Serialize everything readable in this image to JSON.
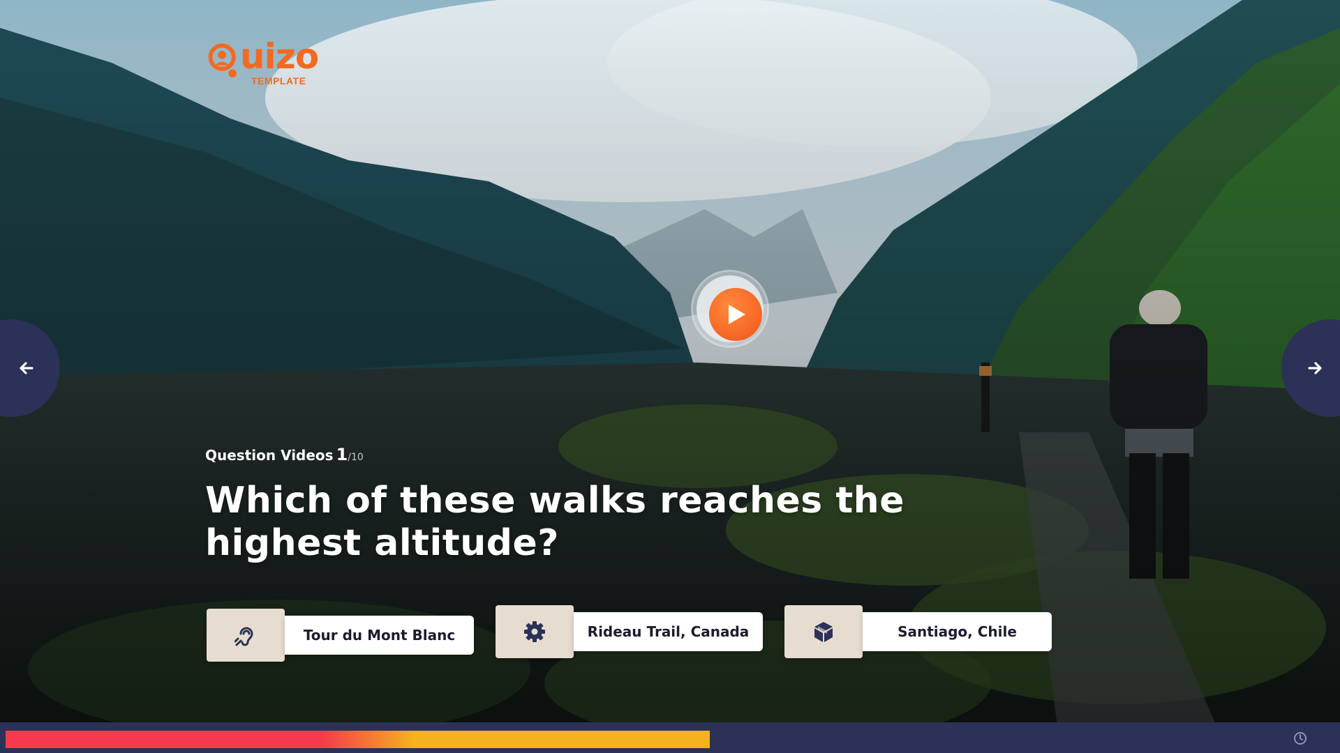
{
  "brand": {
    "name": "Quizo",
    "word": "uizo",
    "subtitle": "TEMPLATE",
    "accent": "#f26a21"
  },
  "question": {
    "label": "Question Videos",
    "number": "1",
    "total": "/10",
    "text": "Which of these walks reaches the highest altitude?"
  },
  "answers": [
    {
      "label": "Tour du Mont Blanc",
      "icon": "hearing-icon"
    },
    {
      "label": "Rideau Trail, Canada",
      "icon": "gear-icon"
    },
    {
      "label": "Santiago, Chile",
      "icon": "cube-icon"
    }
  ],
  "progress": {
    "fraction": 0.53,
    "colors": [
      "#f53b4b",
      "#f5b21e"
    ]
  },
  "colors": {
    "nav": "#2b3157",
    "answer_icon_bg": "#e6ddd0",
    "play": "#f2541a"
  },
  "icons": {
    "prev": "arrow-left-icon",
    "next": "arrow-right-icon",
    "play": "play-icon",
    "timer": "clock-icon"
  }
}
